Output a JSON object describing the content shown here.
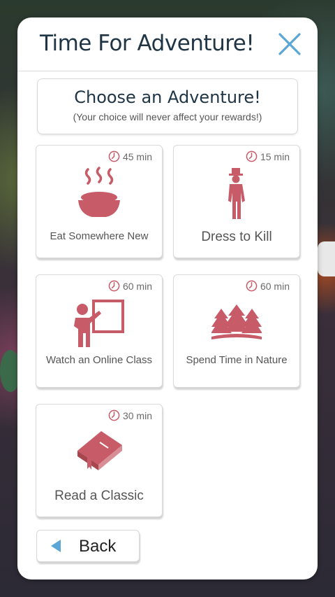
{
  "dialog": {
    "title": "Time For Adventure!",
    "close_icon": "close-icon"
  },
  "intro": {
    "heading": "Choose an Adventure!",
    "subtitle": "(Your choice will never affect your rewards!)"
  },
  "adventures": [
    {
      "label": "Eat Somewhere New",
      "duration": "45 min",
      "icon": "food-bowl-icon"
    },
    {
      "label": "Dress to Kill",
      "duration": "15 min",
      "icon": "gentleman-icon"
    },
    {
      "label": "Watch an Online Class",
      "duration": "60 min",
      "icon": "teacher-board-icon"
    },
    {
      "label": "Spend Time in Nature",
      "duration": "60 min",
      "icon": "trees-icon"
    },
    {
      "label": "Read a Classic",
      "duration": "30 min",
      "icon": "book-icon"
    }
  ],
  "back_button": {
    "label": "Back",
    "icon": "back-arrow-icon"
  },
  "colors": {
    "accent": "#c75b68",
    "title": "#1f3444",
    "close": "#5aa6d6"
  }
}
